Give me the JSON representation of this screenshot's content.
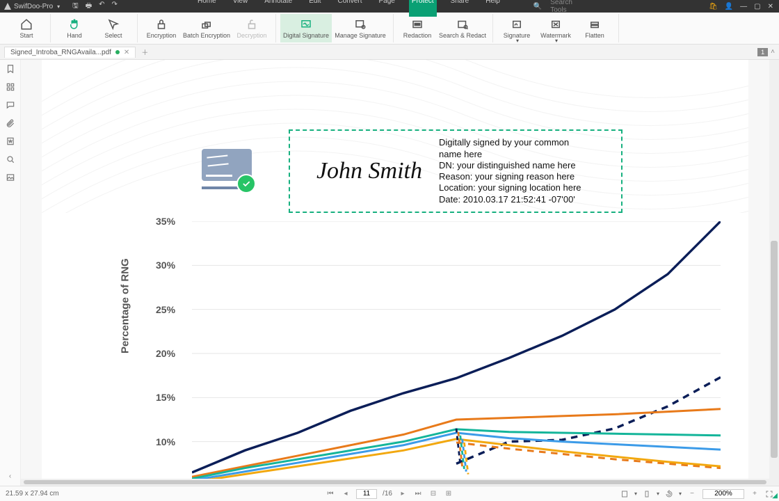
{
  "app": {
    "name": "SwifDoo-Pro"
  },
  "menu": [
    "Home",
    "View",
    "Annotate",
    "Edit",
    "Convert",
    "Page",
    "Protect",
    "Share",
    "Help"
  ],
  "menu_active": "Protect",
  "search_placeholder": "Search Tools",
  "ribbon": {
    "start": "Start",
    "hand": "Hand",
    "select": "Select",
    "encryption": "Encryption",
    "batch": "Batch Encryption",
    "decryption": "Decryption",
    "digital": "Digital Signature",
    "manage": "Manage Signature",
    "redaction": "Redaction",
    "search_redact": "Search & Redact",
    "signature": "Signature",
    "watermark": "Watermark",
    "flatten": "Flatten"
  },
  "tab": {
    "name": "Signed_Introba_RNGAvaila...pdf"
  },
  "page_counter_badge": "1",
  "signature": {
    "name": "John Smith",
    "l1": "Digitally signed by your common",
    "l2": "name here",
    "l3": "DN: your distinguished name here",
    "l4": "Reason: your signing reason here",
    "l5": "Location: your signing location here",
    "l6": "Date: 2010.03.17 21:52:41 -07'00'"
  },
  "chart_data": {
    "type": "line",
    "ylabel": "Percentage of RNG",
    "ylim": [
      5,
      35
    ],
    "yticks": [
      "35%",
      "30%",
      "25%",
      "20%",
      "15%",
      "10%"
    ],
    "x": [
      0,
      1,
      2,
      3,
      4,
      5,
      6,
      7,
      8,
      9,
      10
    ],
    "series": [
      {
        "name": "navy-solid",
        "color": "#0b1e58",
        "style": "solid",
        "values": [
          6.5,
          9,
          11,
          13.5,
          15.5,
          17.2,
          19.5,
          22,
          25,
          29,
          35
        ]
      },
      {
        "name": "navy-dashed",
        "color": "#0b1e58",
        "style": "dashed",
        "values": [
          null,
          null,
          null,
          null,
          null,
          7.5,
          10,
          10.2,
          11.5,
          14,
          17.3
        ]
      },
      {
        "name": "orange-solid",
        "color": "#e87a1a",
        "style": "solid",
        "values": [
          6,
          7.2,
          8.4,
          9.6,
          10.8,
          12.5,
          12.7,
          12.9,
          13.1,
          13.4,
          13.7
        ]
      },
      {
        "name": "orange-dashed",
        "color": "#e87a1a",
        "style": "dashed",
        "values": [
          null,
          null,
          null,
          null,
          null,
          9.9,
          9.2,
          8.6,
          8.0,
          7.5,
          7.0
        ]
      },
      {
        "name": "teal",
        "color": "#14b59a",
        "style": "solid",
        "values": [
          5.8,
          7.0,
          8.0,
          9.0,
          10.0,
          11.4,
          11.1,
          11.0,
          10.9,
          10.8,
          10.7
        ]
      },
      {
        "name": "blue",
        "color": "#3c9be8",
        "style": "solid",
        "values": [
          5.6,
          6.6,
          7.6,
          8.6,
          9.6,
          11.0,
          10.4,
          10.0,
          9.7,
          9.4,
          9.1
        ]
      },
      {
        "name": "gold",
        "color": "#f2a80f",
        "style": "solid",
        "values": [
          5.4,
          6.3,
          7.2,
          8.1,
          9.0,
          10.3,
          9.6,
          8.9,
          8.3,
          7.7,
          7.2
        ]
      }
    ]
  },
  "status": {
    "dims": "21.59 x 27.94 cm",
    "page": "11",
    "total": "/16",
    "zoom": "200%"
  }
}
